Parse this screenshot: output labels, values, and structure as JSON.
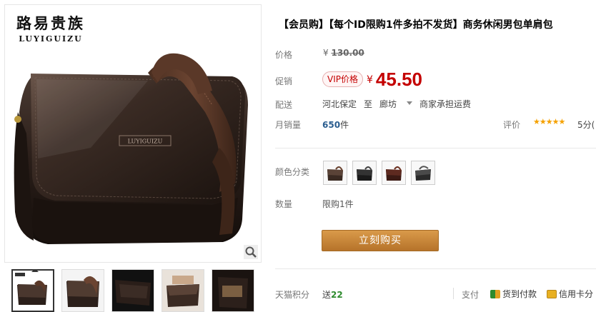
{
  "brand": {
    "name_cn": "路易贵族",
    "name_en": "LUYIGUIZU",
    "embossed_logo": "LUYIGUIZU"
  },
  "product": {
    "title": "【会员购】【每个ID限购1件多拍不发货】商务休闲男包单肩包"
  },
  "price": {
    "label": "价格",
    "currency": "¥",
    "original": "130.00"
  },
  "promo": {
    "label": "促销",
    "tag": "VIP价格",
    "currency": "¥",
    "price": "45.50"
  },
  "shipping": {
    "label": "配送",
    "from": "河北保定",
    "to_word": "至",
    "destination": "廊坊",
    "fee_note": "商家承担运费"
  },
  "sales": {
    "label": "月销量",
    "count": "650",
    "unit": "件"
  },
  "rating": {
    "label": "评价",
    "stars": "★★★★★",
    "score": "5分("
  },
  "color": {
    "label": "颜色分类",
    "options_count": 4
  },
  "quantity": {
    "label": "数量",
    "limit_text": "限购1件"
  },
  "buy_button": {
    "label": "立刻购买"
  },
  "points": {
    "label": "天猫积分",
    "prefix": "送",
    "value": "22"
  },
  "payment": {
    "label": "支付",
    "method1": "货到付款",
    "method2": "信用卡分"
  },
  "colors": {
    "accent_red": "#c40000",
    "buy_button": "#c68438",
    "star": "#f5a100",
    "points_green": "#2e8b2e",
    "sales_blue": "#2a5d8f"
  },
  "icons": [
    "zoom-icon",
    "cod-icon",
    "credit-card-icon",
    "dropdown-arrow-icon"
  ]
}
